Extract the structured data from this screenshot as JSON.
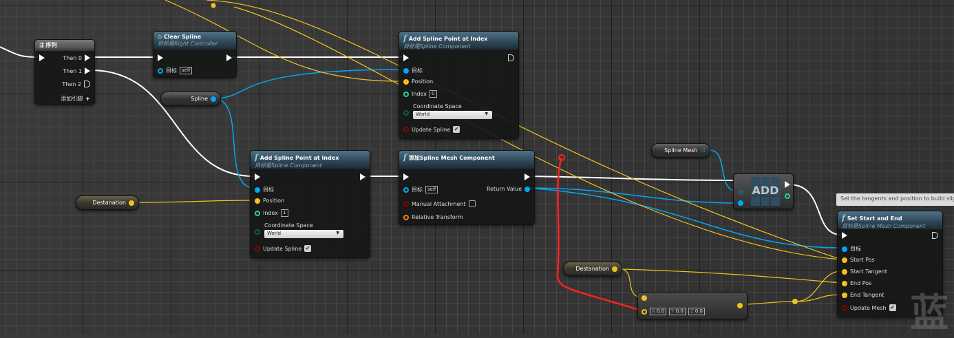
{
  "colors": {
    "exec": "#ffffff",
    "object": "#00a8f4",
    "vector": "#f2c21b",
    "int": "#1dd79b",
    "enum": "#0f5c4f",
    "bool": "#8c0000",
    "transform": "#f07a16",
    "highlight": "#ff2222"
  },
  "sequence": {
    "title": "序列",
    "outputs": [
      "Then 0",
      "Then 1",
      "Then 2"
    ],
    "add_pin": "添加引脚"
  },
  "clear_spline": {
    "title": "Clear Spline",
    "subtitle": "目标是Right Controller",
    "target_label": "目标",
    "target_value": "self"
  },
  "spline_getter": {
    "label": "Spline"
  },
  "add_point_top": {
    "title": "Add Spline Point at Index",
    "subtitle": "目标是Spline Component",
    "target_label": "目标",
    "position_label": "Position",
    "index_label": "Index",
    "index_value": "0",
    "coord_label": "Coordinate Space",
    "coord_value": "World",
    "update_label": "Update Spline",
    "update_checked": true
  },
  "add_point_bottom": {
    "title": "Add Spline Point at Index",
    "subtitle": "目标是Spline Component",
    "target_label": "目标",
    "position_label": "Position",
    "index_label": "Index",
    "index_value": "1",
    "coord_label": "Coordinate Space",
    "coord_value": "World",
    "update_label": "Update Spline",
    "update_checked": true
  },
  "destanation_getter": {
    "label": "Destanation"
  },
  "add_mesh": {
    "title": "添加Spline Mesh Component",
    "target_label": "目标",
    "target_value": "self",
    "return_label": "Return Value",
    "manual_label": "Manual Attachment",
    "manual_checked": false,
    "transform_label": "Relative Transform"
  },
  "spline_mesh_getter": {
    "label": "Spline Mesh"
  },
  "add_array": {
    "label": "ADD"
  },
  "tooltip": {
    "text": "Set the tangents and position to build slig"
  },
  "set_start_end": {
    "title": "Set Start and End",
    "subtitle": "目标是Spline Mesh Component",
    "target_label": "目标",
    "pins": [
      "Start Pos",
      "Start Tangent",
      "End Pos",
      "End Tangent"
    ],
    "update_label": "Update Mesh",
    "update_checked": true
  },
  "destanation_getter2": {
    "label": "Destanation"
  },
  "vector_node": {
    "x_label": "X",
    "x_value": "0.0",
    "y_label": "Y",
    "y_value": "0.0",
    "z_label": "Z",
    "z_value": "0.0"
  },
  "watermark": "蓝"
}
